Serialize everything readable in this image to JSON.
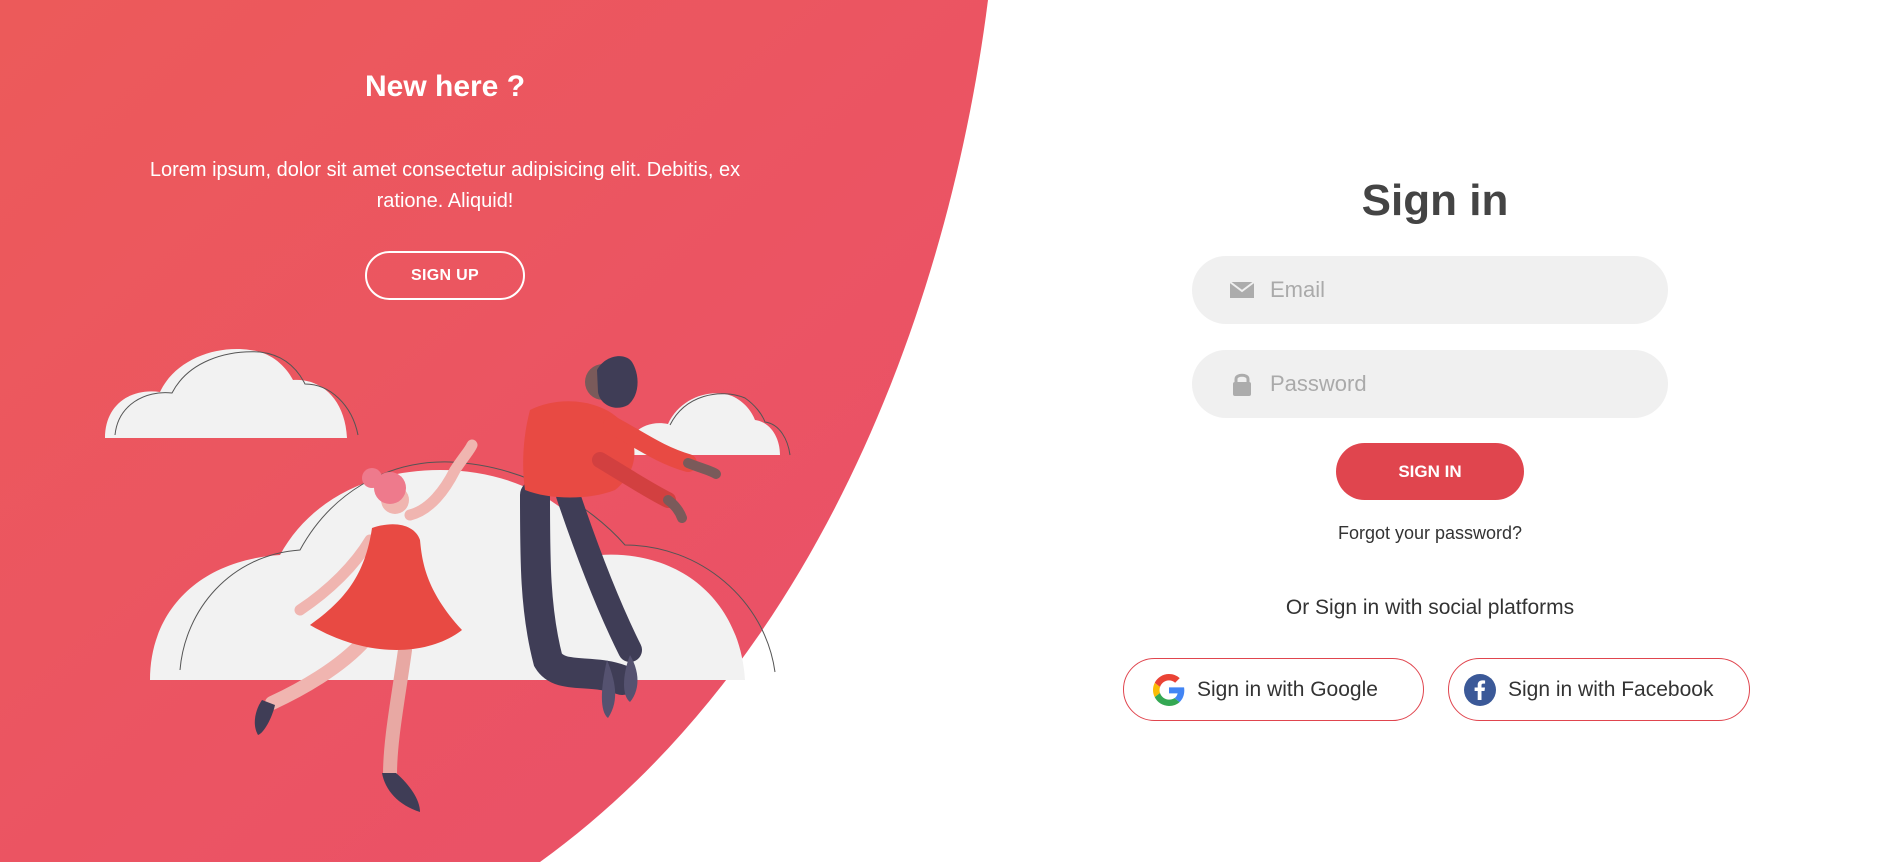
{
  "colors": {
    "accent": "#e0454e",
    "panel_gradient_start": "#ec5a5a",
    "panel_gradient_end": "#ea4f6a",
    "input_background": "#f0f0f0",
    "title_text": "#444444"
  },
  "left_panel": {
    "title": "New here ?",
    "text": "Lorem ipsum, dolor sit amet consectetur adipisicing elit. Debitis, ex ratione. Aliquid!",
    "signup_label": "SIGN UP",
    "illustration": "two-people-dancing-on-clouds"
  },
  "sign_in_form": {
    "title": "Sign in",
    "email": {
      "placeholder": "Email",
      "value": "",
      "icon": "envelope-icon"
    },
    "password": {
      "placeholder": "Password",
      "value": "",
      "icon": "lock-icon"
    },
    "submit_label": "SIGN IN",
    "forgot_password": "Forgot your password?",
    "social_text": "Or Sign in with social platforms",
    "google_label": "Sign in with Google",
    "facebook_label": "Sign in with Facebook"
  }
}
